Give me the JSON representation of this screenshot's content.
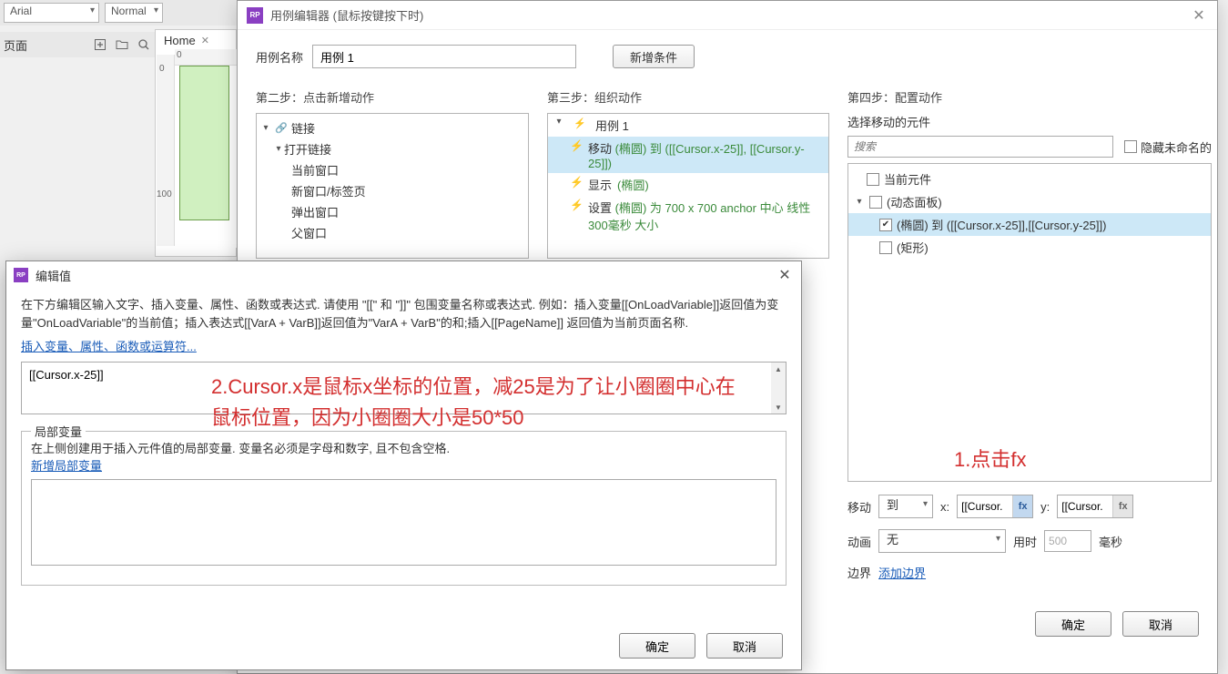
{
  "bg": {
    "font": "Arial",
    "style": "Normal",
    "page_label": "页面",
    "home_tab": "Home",
    "ruler_0": "0",
    "ruler_100": "100"
  },
  "case_editor": {
    "title": "用例编辑器 (鼠标按键按下时)",
    "case_name_label": "用例名称",
    "case_name_value": "用例 1",
    "add_condition": "新增条件",
    "step2_label": "第二步：点击新增动作",
    "step3_label": "第三步：组织动作",
    "step4_label": "第四步：配置动作",
    "tree": {
      "links": "链接",
      "open_link": "打开链接",
      "current_window": "当前窗口",
      "new_window": "新窗口/标签页",
      "popup": "弹出窗口",
      "parent": "父窗口"
    },
    "actions": {
      "case": "用例 1",
      "move_name": "移动",
      "move_detail": "(椭圆) 到 ([[Cursor.x-25]], [[Cursor.y-25]])",
      "show_name": "显示",
      "show_detail": "(椭圆)",
      "set_name": "设置",
      "set_detail": "(椭圆)  为 700 x 700 anchor 中心 线性 300毫秒 大小"
    },
    "widget_section": "选择移动的元件",
    "search_placeholder": "搜索",
    "hide_unnamed": "隐藏未命名的",
    "widgets": {
      "current": "当前元件",
      "panel": "(动态面板)",
      "ellipse": "(椭圆) 到 ([[Cursor.x-25]],[[Cursor.y-25]])",
      "rect": "(矩形)"
    },
    "config": {
      "move_label": "移动",
      "move_mode": "到",
      "x_label": "x:",
      "y_label": "y:",
      "x_value": "[[Cursor.",
      "y_value": "[[Cursor.",
      "fx": "fx",
      "anim_label": "动画",
      "anim_value": "无",
      "duration_label": "用时",
      "duration_value": "500",
      "ms": "毫秒",
      "bounds_label": "边界",
      "add_bounds": "添加边界"
    },
    "ok": "确定",
    "cancel": "取消"
  },
  "edit_value": {
    "title": "编辑值",
    "desc": "在下方编辑区输入文字、插入变量、属性、函数或表达式. 请使用 \"[[\" 和 \"]]\"  包围变量名称或表达式. 例如：插入变量[[OnLoadVariable]]返回值为变量\"OnLoadVariable\"的当前值；插入表达式[[VarA + VarB]]返回值为\"VarA + VarB\"的和;插入[[PageName]] 返回值为当前页面名称.",
    "insert_link": "插入变量、属性、函数或运算符...",
    "value": "[[Cursor.x-25]]",
    "local_legend": "局部变量",
    "local_desc": "在上侧创建用于插入元件值的局部变量. 变量名必须是字母和数字, 且不包含空格.",
    "add_local": "新增局部变量",
    "ok": "确定",
    "cancel": "取消"
  },
  "annotations": {
    "a1": "1.点击fx",
    "a2": "2.Cursor.x是鼠标x坐标的位置，减25是为了让小圈圈中心在鼠标位置，因为小圈圈大小是50*50"
  }
}
